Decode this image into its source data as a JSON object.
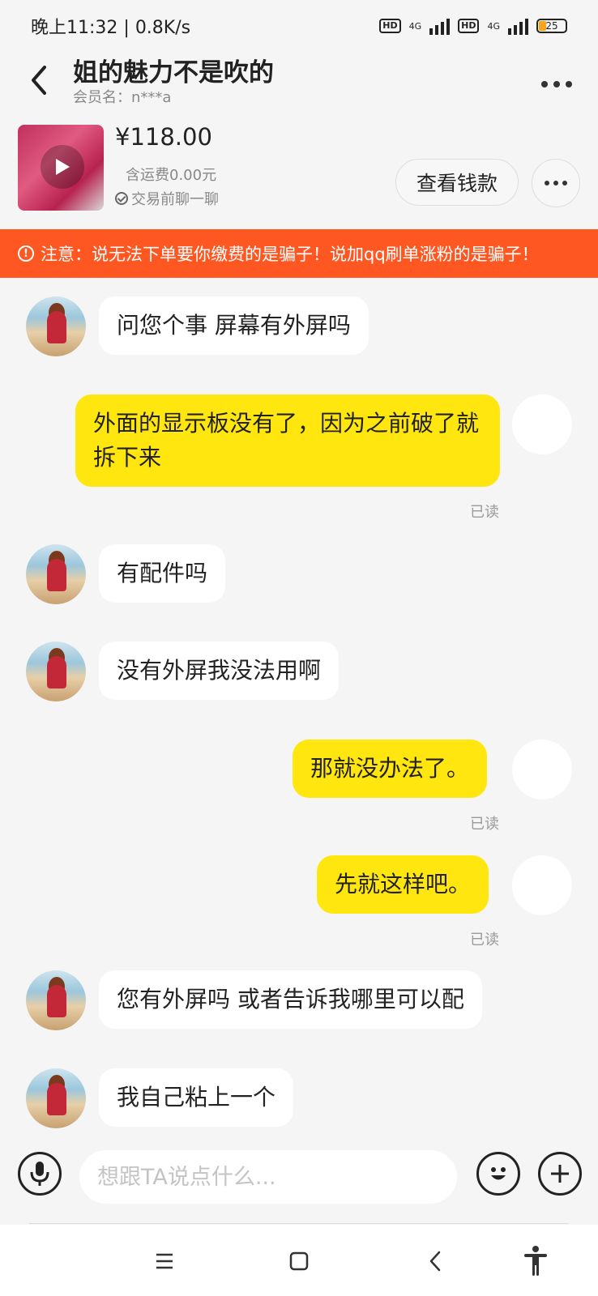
{
  "status": {
    "time": "晚上11:32",
    "speed": "0.8K/s",
    "network1": "4G",
    "network2": "4G",
    "hd1": "HD",
    "hd2": "HD",
    "battery": "25",
    "battery_level": 0.25
  },
  "header": {
    "title": "姐的魅力不是吹的",
    "subtitle": "会员名：n***a"
  },
  "product": {
    "price": "¥118.00",
    "shipping": "含运费0.00元",
    "chat_before": "交易前聊一聊",
    "view_button": "查看钱款"
  },
  "warning": {
    "text": "注意：说无法下单要你缴费的是骗子！说加qq刷单涨粉的是骗子！"
  },
  "messages": [
    {
      "side": "left",
      "text": "问您个事 屏幕有外屏吗"
    },
    {
      "side": "right",
      "text": "外面的显示板没有了，因为之前破了就拆下来",
      "status": "已读"
    },
    {
      "side": "left",
      "text": "有配件吗"
    },
    {
      "side": "left",
      "text": "没有外屏我没法用啊"
    },
    {
      "side": "right",
      "text": "那就没办法了。",
      "status": "已读"
    },
    {
      "side": "right",
      "text": "先就这样吧。",
      "status": "已读"
    },
    {
      "side": "left",
      "text": "您有外屏吗 或者告诉我哪里可以配"
    },
    {
      "side": "left",
      "text": "我自己粘上一个"
    }
  ],
  "input": {
    "placeholder": "想跟TA说点什么..."
  },
  "colors": {
    "accent": "#ffe60f",
    "warning": "#ff5722",
    "background": "#f5f5f5"
  }
}
